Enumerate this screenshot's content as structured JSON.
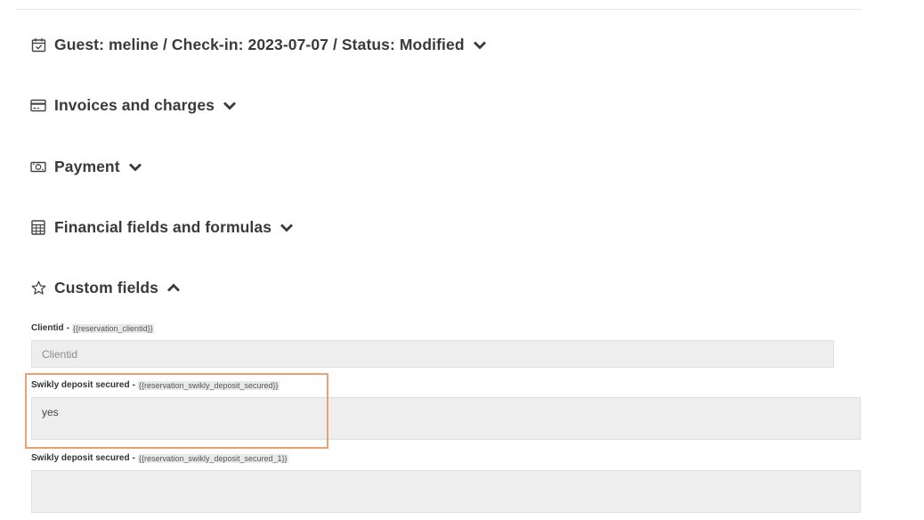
{
  "sections": [
    {
      "id": "reservation",
      "title": "Guest: meline / Check-in: 2023-07-07 / Status: Modified",
      "icon": "calendar-check-icon",
      "expanded": false
    },
    {
      "id": "invoices",
      "title": "Invoices and charges",
      "icon": "credit-card-icon",
      "expanded": false
    },
    {
      "id": "payment",
      "title": "Payment",
      "icon": "money-bill-icon",
      "expanded": false
    },
    {
      "id": "financial",
      "title": "Financial fields and formulas",
      "icon": "calculator-icon",
      "expanded": false
    },
    {
      "id": "custom",
      "title": "Custom fields",
      "icon": "star-icon",
      "expanded": true
    }
  ],
  "custom_fields": [
    {
      "label": "Clientid",
      "tag": "{{reservation_clientid}}",
      "value": "",
      "placeholder": "Clientid"
    },
    {
      "label": "Swikly deposit secured",
      "tag": "{{reservation_swikly_deposit_secured}}",
      "value": "yes",
      "placeholder": ""
    },
    {
      "label": "Swikly deposit secured",
      "tag": "{{reservation_swikly_deposit_secured_1}}",
      "value": "",
      "placeholder": ""
    }
  ],
  "label_separator": "-",
  "colors": {
    "highlight": "#f0a070",
    "input_bg": "#eeeeee",
    "title_text": "#3a3a3a"
  }
}
